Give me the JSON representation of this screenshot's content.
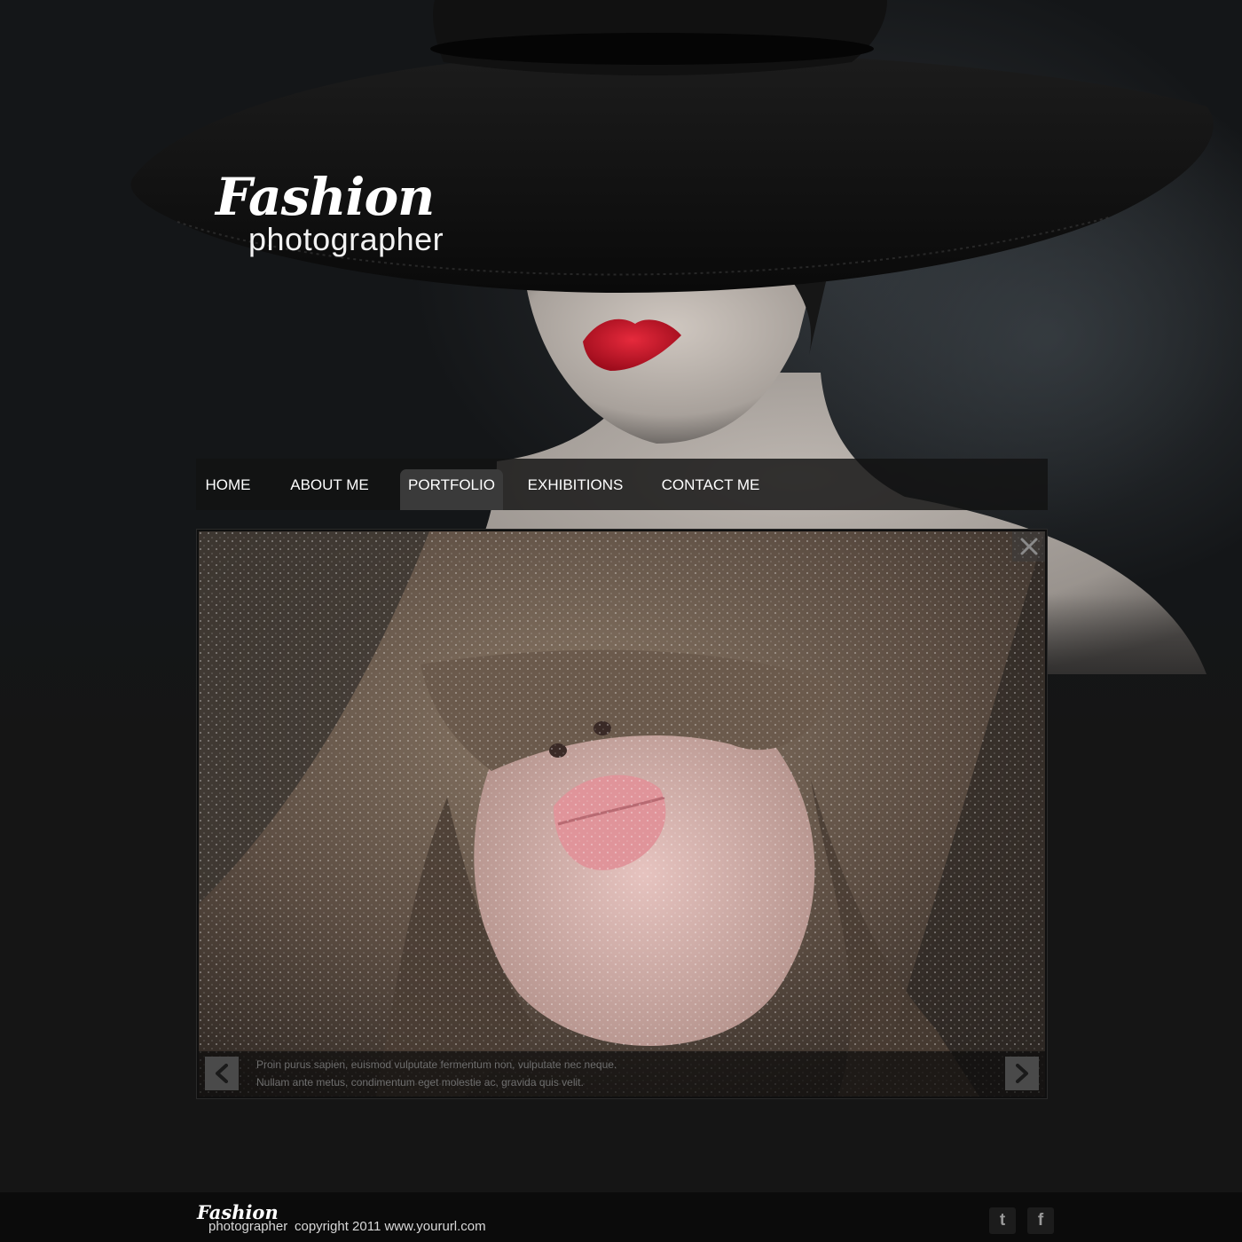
{
  "brand": {
    "logo_main": "Fashion",
    "logo_sub": "photographer"
  },
  "nav": {
    "items": [
      {
        "label": "HOME",
        "active": false
      },
      {
        "label": "ABOUT ME",
        "active": false
      },
      {
        "label": "PORTFOLIO",
        "active": true
      },
      {
        "label": "EXHIBITIONS",
        "active": false
      },
      {
        "label": "CONTACT ME",
        "active": false
      }
    ]
  },
  "slider": {
    "caption_line1": "Proin purus sapien, euismod vulputate fermentum non, vulputate nec neque.",
    "caption_line2": "Nullam ante metus, condimentum eget molestie ac, gravida quis velit.",
    "prev_icon": "chevron-left-icon",
    "next_icon": "chevron-right-icon",
    "close_icon": "close-icon"
  },
  "footer": {
    "logo_main": "Fashion",
    "logo_sub": "photographer",
    "copyright": "copyright 2011 www.yoururl.com",
    "social": [
      {
        "name": "twitter-icon",
        "glyph": "t"
      },
      {
        "name": "facebook-icon",
        "glyph": "f"
      }
    ]
  },
  "colors": {
    "page_bg": "#151515",
    "footer_bg": "#0b0b0b",
    "nav_active_bg": "#3a3a3a",
    "lip_red": "#d0142a"
  }
}
